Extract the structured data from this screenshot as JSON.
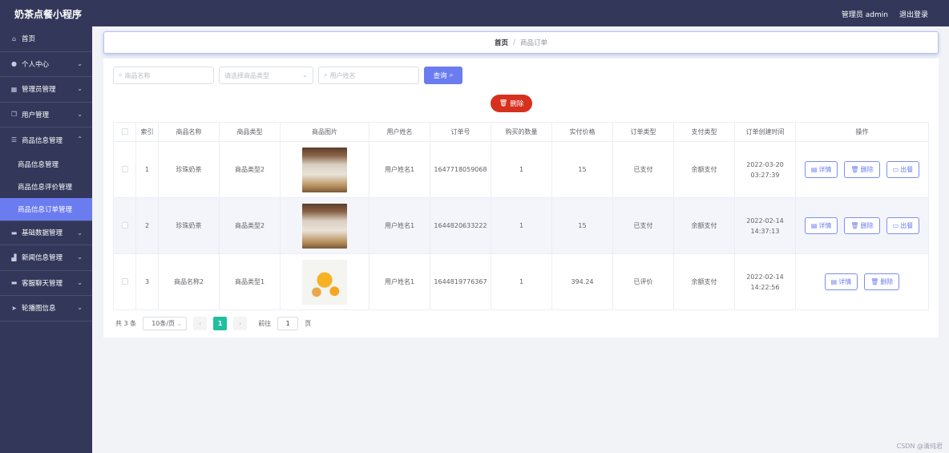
{
  "header": {
    "app_title": "奶茶点餐小程序",
    "admin_label": "管理员 admin",
    "logout": "退出登录"
  },
  "sidebar": {
    "items": [
      {
        "label": "首页",
        "icon": "home-icon"
      },
      {
        "label": "个人中心",
        "icon": "user-icon",
        "expandable": true
      },
      {
        "label": "管理员管理",
        "icon": "grid-icon",
        "expandable": true
      },
      {
        "label": "用户管理",
        "icon": "copy-icon",
        "expandable": true
      },
      {
        "label": "商品信息管理",
        "icon": "list-icon",
        "expandable": true,
        "expanded": true
      },
      {
        "label": "基础数据管理",
        "icon": "folder-icon",
        "expandable": true
      },
      {
        "label": "新闻信息管理",
        "icon": "chart-icon",
        "expandable": true
      },
      {
        "label": "客服聊天管理",
        "icon": "folder-icon",
        "expandable": true
      },
      {
        "label": "轮播图信息",
        "icon": "send-icon",
        "expandable": true
      }
    ],
    "sub_items": [
      {
        "label": "商品信息管理"
      },
      {
        "label": "商品信息评价管理"
      },
      {
        "label": "商品信息订单管理",
        "active": true
      }
    ]
  },
  "breadcrumb": {
    "home": "首页",
    "separator": "/",
    "current": "商品订单"
  },
  "search": {
    "name_placeholder": "商品名称",
    "type_placeholder": "请选择商品类型",
    "user_placeholder": "用户姓名",
    "query_label": "查询"
  },
  "delete_label": "删除",
  "table": {
    "headers": [
      "索引",
      "商品名称",
      "商品类型",
      "商品图片",
      "用户姓名",
      "订单号",
      "购买的数量",
      "实付价格",
      "订单类型",
      "支付类型",
      "订单创建时间",
      "操作"
    ],
    "rows": [
      {
        "index": "1",
        "name": "珍珠奶茶",
        "type": "商品类型2",
        "image": "milk-tea-image",
        "user": "用户姓名1",
        "order_no": "1647718059068",
        "qty": "1",
        "price": "15",
        "order_type": "已支付",
        "pay_type": "余额支付",
        "created": "2022-03-20 03:27:39",
        "ops": [
          "详情",
          "删除",
          "出餐"
        ]
      },
      {
        "index": "2",
        "name": "珍珠奶茶",
        "type": "商品类型2",
        "image": "milk-tea-image",
        "user": "用户姓名1",
        "order_no": "1644820633222",
        "qty": "1",
        "price": "15",
        "order_type": "已支付",
        "pay_type": "余额支付",
        "created": "2022-02-14 14:37:13",
        "ops": [
          "详情",
          "删除",
          "出餐"
        ]
      },
      {
        "index": "3",
        "name": "商品名称2",
        "type": "商品类型1",
        "image": "orange-juice-image",
        "user": "用户姓名1",
        "order_no": "1644819776367",
        "qty": "1",
        "price": "394.24",
        "order_type": "已评价",
        "pay_type": "余额支付",
        "created": "2022-02-14 14:22:56",
        "ops": [
          "详情",
          "删除"
        ]
      }
    ]
  },
  "pagination": {
    "total": "共 3 条",
    "page_size": "10条/页",
    "prev": "‹",
    "page": "1",
    "next": "›",
    "goto_label": "前往",
    "goto_value": "1",
    "page_unit": "页"
  },
  "watermark": "CSDN @清纯君"
}
